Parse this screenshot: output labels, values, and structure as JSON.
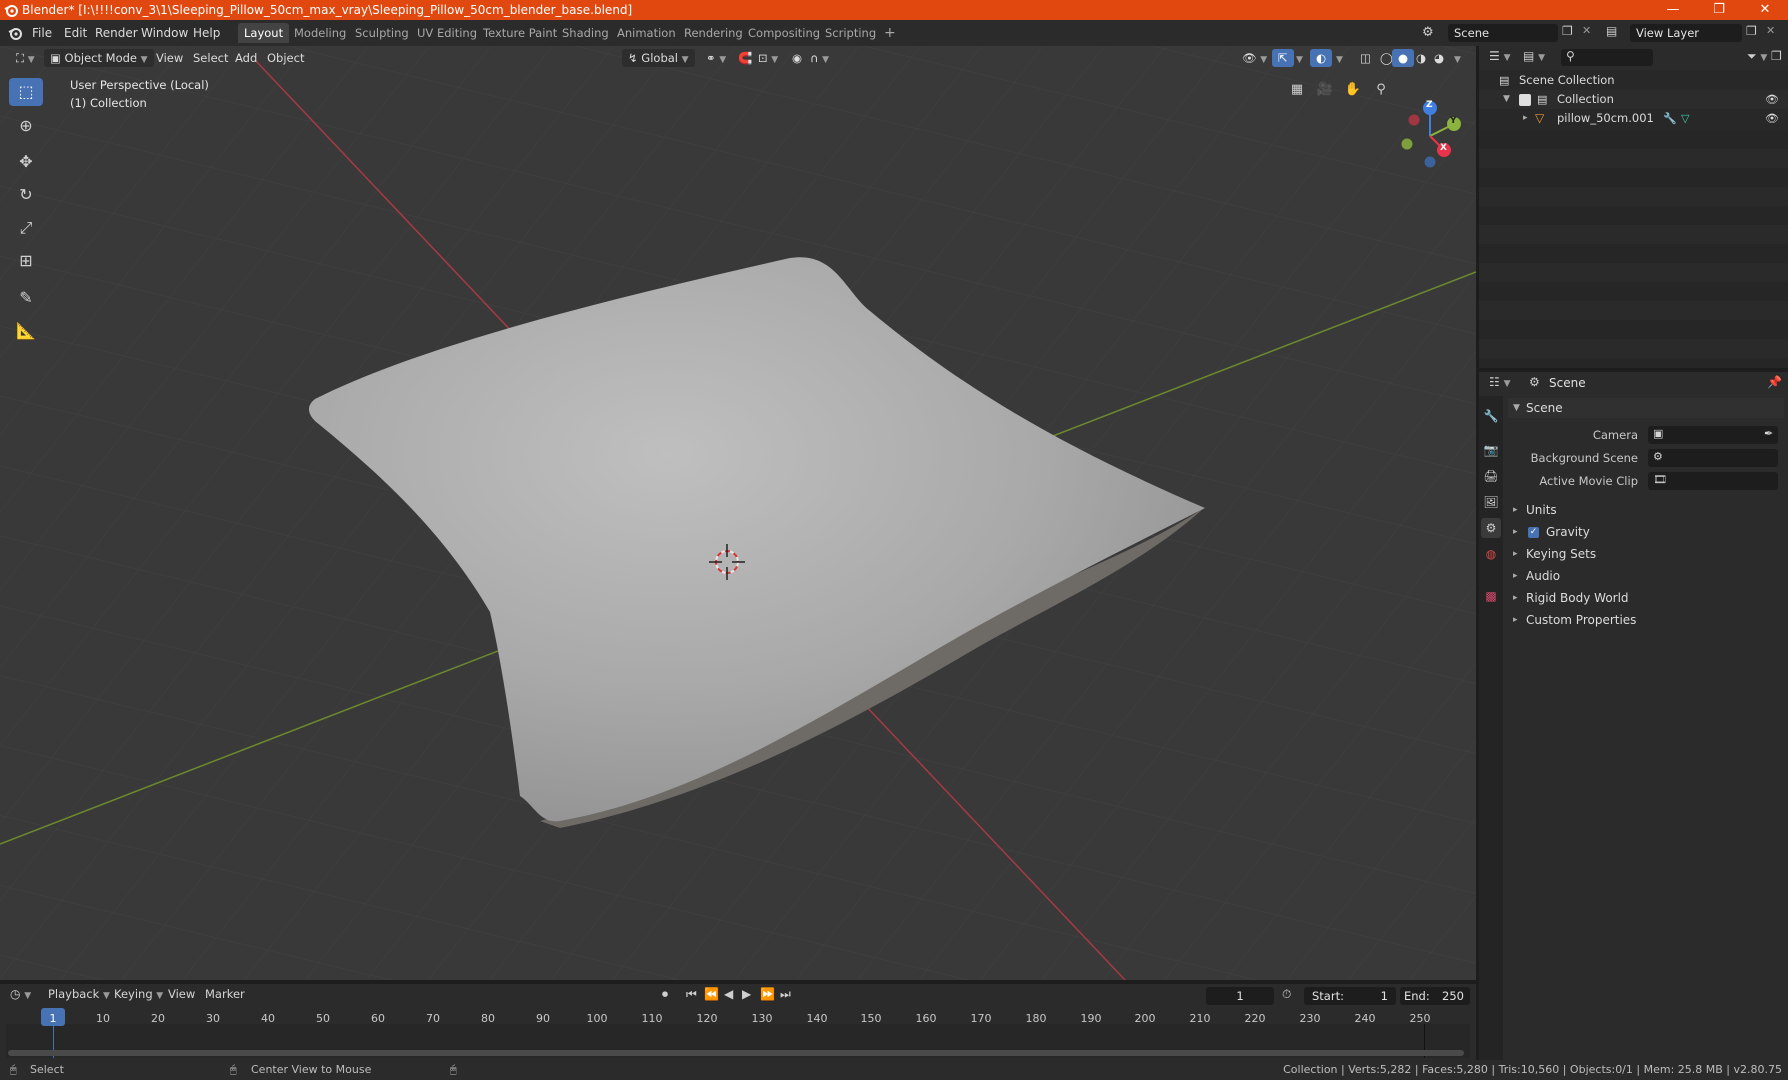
{
  "window": {
    "title": "Blender* [I:\\!!!!conv_3\\1\\Sleeping_Pillow_50cm_max_vray\\Sleeping_Pillow_50cm_blender_base.blend]",
    "minimize": "—",
    "restore": "❐",
    "close": "✕"
  },
  "menu": {
    "file": "File",
    "edit": "Edit",
    "render": "Render",
    "window": "Window",
    "help": "Help"
  },
  "workspaces": [
    "Layout",
    "Modeling",
    "Sculpting",
    "UV Editing",
    "Texture Paint",
    "Shading",
    "Animation",
    "Rendering",
    "Compositing",
    "Scripting"
  ],
  "workspace_add": "+",
  "scene_field": "Scene",
  "view_layer_field": "View Layer",
  "viewport_header": {
    "mode": "Object Mode",
    "view": "View",
    "select": "Select",
    "add": "Add",
    "object": "Object",
    "transform_orientation": "Global"
  },
  "viewport": {
    "perspective": "User Perspective (Local)",
    "collection": "(1) Collection",
    "axis_x": "X",
    "axis_y": "Y",
    "axis_z": "Z"
  },
  "outliner": {
    "search_placeholder": "",
    "scene_collection": "Scene Collection",
    "collection": "Collection",
    "object": "pillow_50cm.001"
  },
  "properties": {
    "header": "Scene",
    "panel": "Scene",
    "camera_label": "Camera",
    "background_scene_label": "Background Scene",
    "active_movie_clip_label": "Active Movie Clip",
    "sections": [
      "Units",
      "Gravity",
      "Keying Sets",
      "Audio",
      "Rigid Body World",
      "Custom Properties"
    ],
    "gravity_checked": true
  },
  "timeline": {
    "playback": "Playback",
    "keying": "Keying",
    "view": "View",
    "marker": "Marker",
    "current_frame": "1",
    "start_label": "Start:",
    "start_value": "1",
    "end_label": "End:",
    "end_value": "250",
    "ticks": [
      "1",
      "10",
      "20",
      "30",
      "40",
      "50",
      "60",
      "70",
      "80",
      "90",
      "100",
      "110",
      "120",
      "130",
      "140",
      "150",
      "160",
      "170",
      "180",
      "190",
      "200",
      "210",
      "220",
      "230",
      "240",
      "250"
    ]
  },
  "status": {
    "select": "Select",
    "center_view": "Center View to Mouse",
    "stats": "Collection | Verts:5,282 | Faces:5,280 | Tris:10,560 | Objects:0/1 | Mem: 25.8 MB | v2.80.75"
  },
  "colors": {
    "title_bar": "#e0480f",
    "active_tool": "#4772b3",
    "axis_x": "#e8334a",
    "axis_y": "#8bb33d",
    "axis_z": "#3f7fe0"
  }
}
